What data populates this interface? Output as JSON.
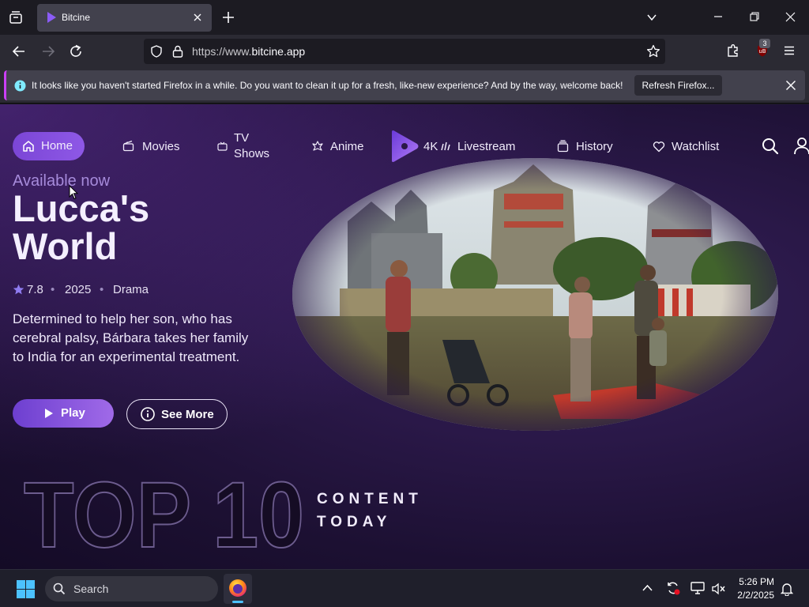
{
  "browser": {
    "tab": {
      "title": "Bitcine"
    },
    "url": {
      "prefix": "https://www.",
      "domain": "bitcine.app"
    },
    "extension_badge": "3",
    "notification": {
      "message": "It looks like you haven't started Firefox in a while. Do you want to clean it up for a fresh, like-new experience? And by the way, welcome back!",
      "button": "Refresh Firefox..."
    }
  },
  "site": {
    "nav": {
      "home": "Home",
      "movies": "Movies",
      "tv_shows_line1": "TV",
      "tv_shows_line2": "Shows",
      "anime": "Anime",
      "livestream_prefix": "4K",
      "livestream": "Livestream",
      "history": "History",
      "watchlist": "Watchlist"
    },
    "hero": {
      "status": "Available now",
      "title_line1": "Lucca's",
      "title_line2": "World",
      "rating": "7.8",
      "year": "2025",
      "genre": "Drama",
      "separator": "•",
      "description": "Determined to help her son, who has cerebral palsy, Bárbara takes her family to India for an experimental treatment.",
      "play": "Play",
      "see_more": "See More"
    },
    "top10": {
      "big": "TOP 10",
      "line1": "CONTENT",
      "line2": "TODAY"
    }
  },
  "taskbar": {
    "search": "Search",
    "time": "5:26 PM",
    "date": "2/2/2025"
  },
  "colors": {
    "accent": "#8e58e6",
    "page_bg": "#2a1848",
    "firefox_notice_border": "#cb3ff5"
  }
}
